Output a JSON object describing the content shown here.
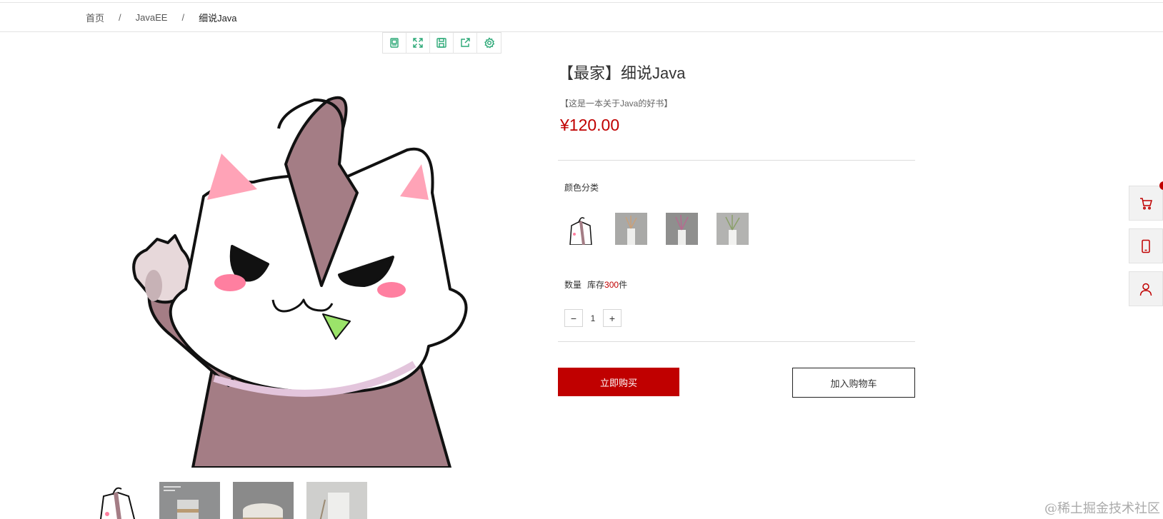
{
  "breadcrumb": {
    "home": "首页",
    "sep": "/",
    "category": "JavaEE",
    "current": "细说Java"
  },
  "product": {
    "title": "【最家】细说Java",
    "subtitle": "【这是一本关于Java的好书】",
    "price": "¥120.00",
    "color_label": "颜色分类",
    "quantity_label": "数量",
    "stock_prefix": "库存",
    "stock_count": "300",
    "stock_suffix": "件",
    "quantity": "1",
    "minus": "−",
    "plus": "+",
    "buy_now": "立即购买",
    "add_to_cart": "加入购物车"
  },
  "image_toolbar": {
    "icons": [
      "book-icon",
      "fullscreen-icon",
      "save-icon",
      "share-icon",
      "settings-icon"
    ]
  },
  "side_tools": {
    "icons": [
      "cart-icon",
      "phone-icon",
      "user-icon"
    ]
  },
  "watermark": "@稀土掘金技术社区",
  "colors": {
    "accent": "#c00000",
    "toolbar_icon": "#2aa876"
  }
}
